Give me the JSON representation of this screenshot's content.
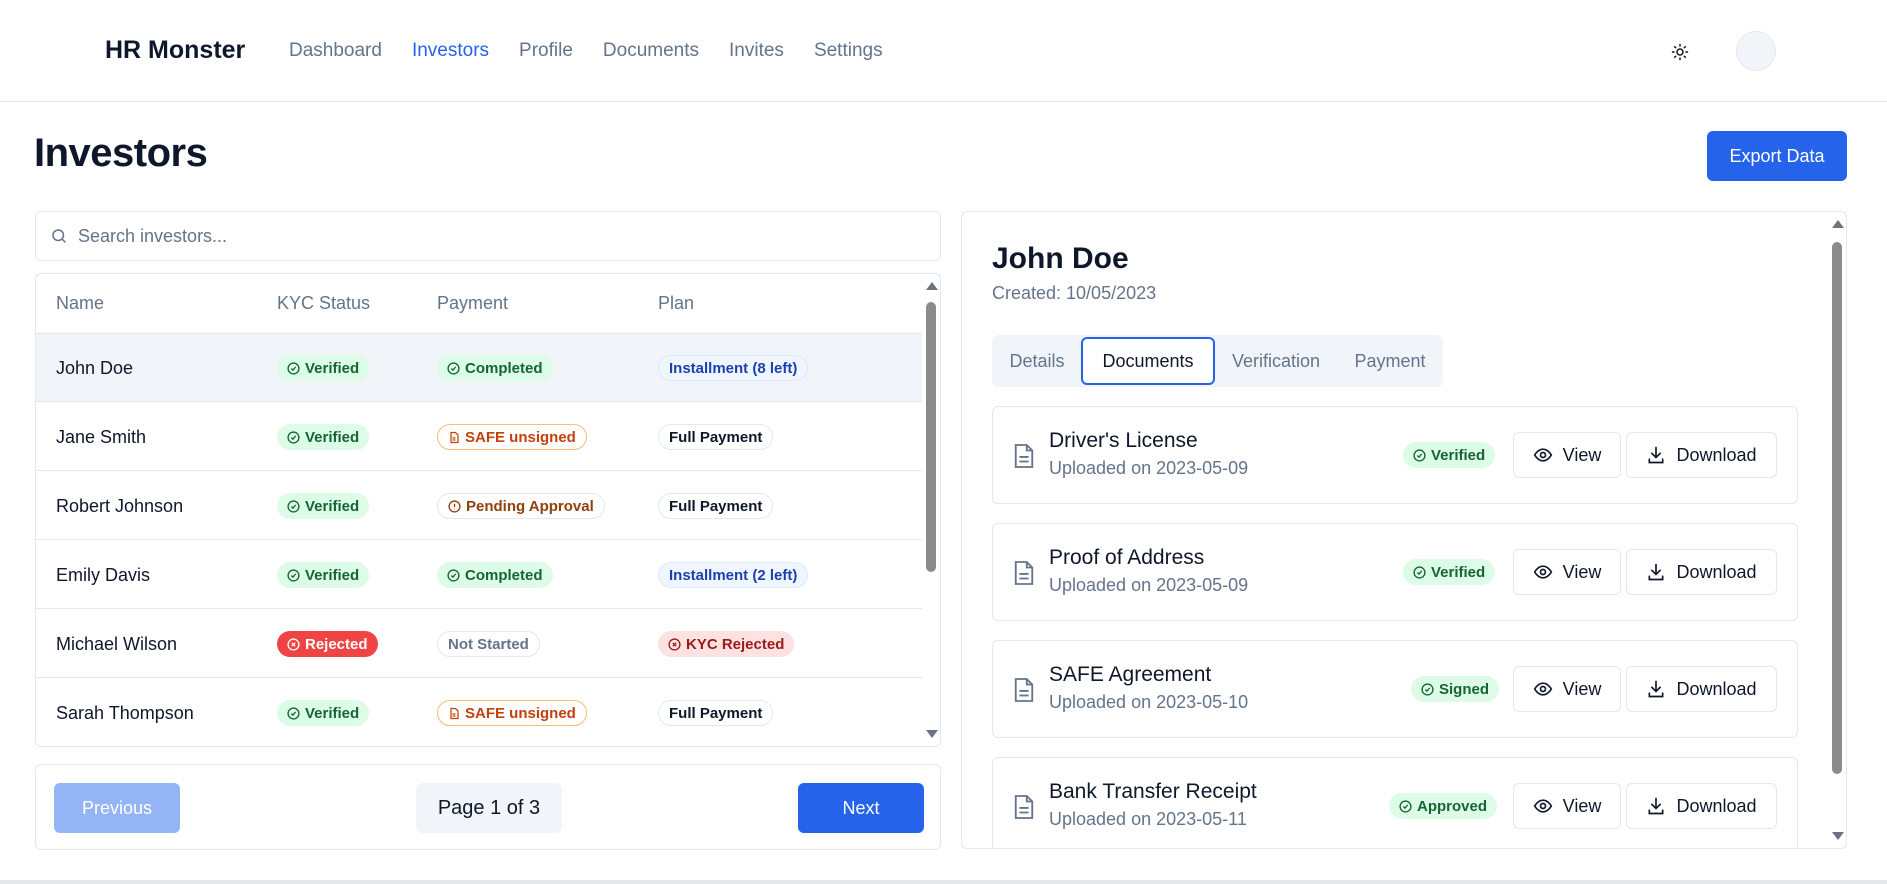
{
  "header": {
    "brand": "HR Monster",
    "nav": [
      {
        "label": "Dashboard",
        "active": false
      },
      {
        "label": "Investors",
        "active": true
      },
      {
        "label": "Profile",
        "active": false
      },
      {
        "label": "Documents",
        "active": false
      },
      {
        "label": "Invites",
        "active": false
      },
      {
        "label": "Settings",
        "active": false
      }
    ],
    "theme_icon": "sun-icon"
  },
  "page": {
    "title": "Investors",
    "export_label": "Export Data"
  },
  "search": {
    "placeholder": "Search investors...",
    "value": ""
  },
  "table": {
    "columns": [
      "Name",
      "KYC Status",
      "Payment",
      "Plan"
    ],
    "rows": [
      {
        "name": "John Doe",
        "kyc": "Verified",
        "payment": "Completed",
        "plan": "Installment (8 left)"
      },
      {
        "name": "Jane Smith",
        "kyc": "Verified",
        "payment": "SAFE unsigned",
        "plan": "Full Payment"
      },
      {
        "name": "Robert Johnson",
        "kyc": "Verified",
        "payment": "Pending Approval",
        "plan": "Full Payment"
      },
      {
        "name": "Emily Davis",
        "kyc": "Verified",
        "payment": "Completed",
        "plan": "Installment (2 left)"
      },
      {
        "name": "Michael Wilson",
        "kyc": "Rejected",
        "payment": "Not Started",
        "plan": "KYC Rejected"
      },
      {
        "name": "Sarah Thompson",
        "kyc": "Verified",
        "payment": "SAFE unsigned",
        "plan": "Full Payment"
      }
    ]
  },
  "pagination": {
    "previous_label": "Previous",
    "page_label": "Page 1 of 3",
    "next_label": "Next"
  },
  "detail": {
    "name": "John Doe",
    "created": "Created: 10/05/2023",
    "tabs": [
      {
        "label": "Details",
        "active": false
      },
      {
        "label": "Documents",
        "active": true
      },
      {
        "label": "Verification",
        "active": false
      },
      {
        "label": "Payment",
        "active": false
      }
    ],
    "documents": [
      {
        "title": "Driver's License",
        "uploaded": "Uploaded on 2023-05-09",
        "status": "Verified"
      },
      {
        "title": "Proof of Address",
        "uploaded": "Uploaded on 2023-05-09",
        "status": "Verified"
      },
      {
        "title": "SAFE Agreement",
        "uploaded": "Uploaded on 2023-05-10",
        "status": "Signed"
      },
      {
        "title": "Bank Transfer Receipt",
        "uploaded": "Uploaded on 2023-05-11",
        "status": "Approved"
      }
    ],
    "view_label": "View",
    "download_label": "Download"
  },
  "colors": {
    "accent": "#2563eb",
    "success_bg": "#dcfce7",
    "success_text": "#166534",
    "danger": "#ef4444"
  }
}
